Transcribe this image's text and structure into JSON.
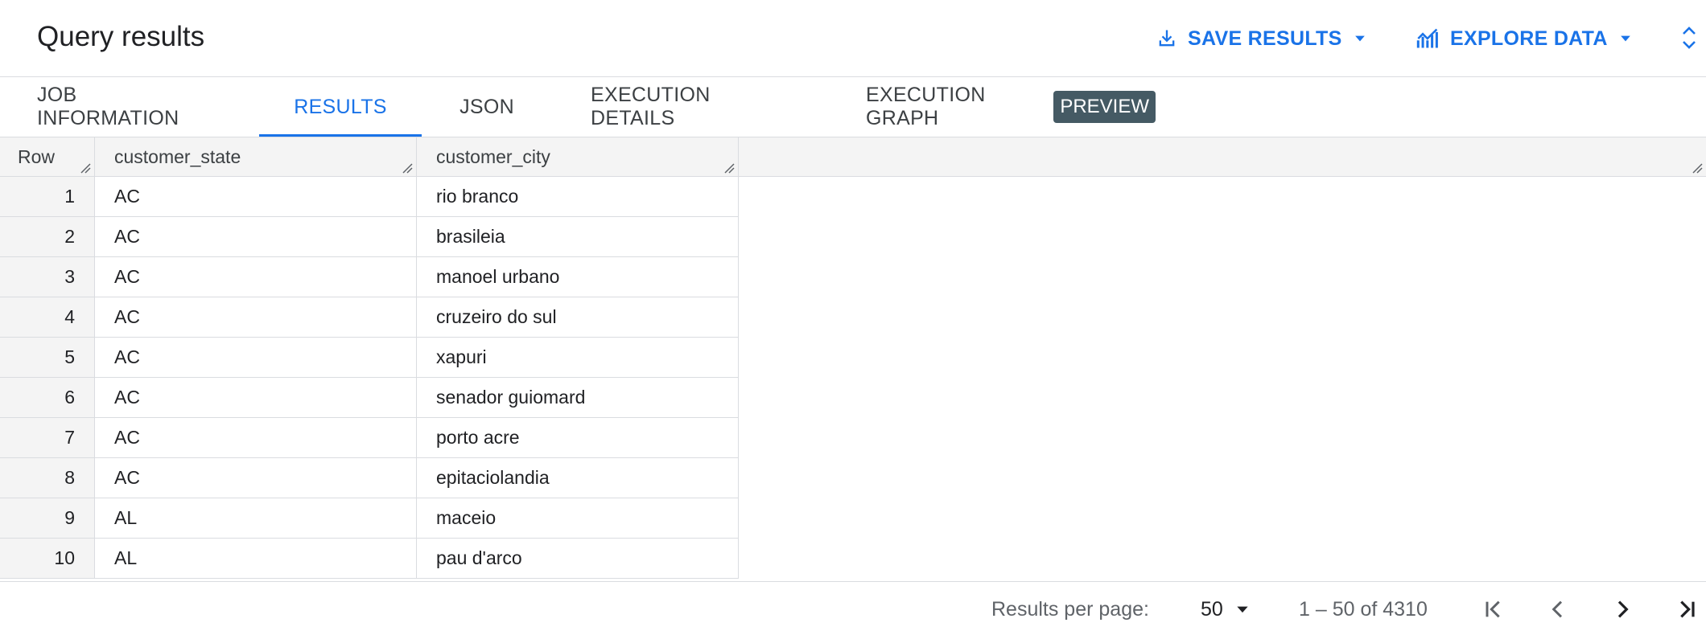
{
  "header": {
    "title": "Query results",
    "save_label": "SAVE RESULTS",
    "explore_label": "EXPLORE DATA"
  },
  "tabs": [
    {
      "label": "JOB INFORMATION"
    },
    {
      "label": "RESULTS",
      "active": true
    },
    {
      "label": "JSON"
    },
    {
      "label": "EXECUTION DETAILS"
    },
    {
      "label": "EXECUTION GRAPH",
      "badge": "PREVIEW"
    }
  ],
  "table": {
    "columns": [
      "Row",
      "customer_state",
      "customer_city"
    ],
    "rows": [
      [
        "1",
        "AC",
        "rio branco"
      ],
      [
        "2",
        "AC",
        "brasileia"
      ],
      [
        "3",
        "AC",
        "manoel urbano"
      ],
      [
        "4",
        "AC",
        "cruzeiro do sul"
      ],
      [
        "5",
        "AC",
        "xapuri"
      ],
      [
        "6",
        "AC",
        "senador guiomard"
      ],
      [
        "7",
        "AC",
        "porto acre"
      ],
      [
        "8",
        "AC",
        "epitaciolandia"
      ],
      [
        "9",
        "AL",
        "maceio"
      ],
      [
        "10",
        "AL",
        "pau d'arco"
      ]
    ]
  },
  "footer": {
    "per_page_label": "Results per page:",
    "per_page_value": "50",
    "range_text": "1 – 50 of 4310"
  },
  "colors": {
    "accent": "#1a73e8",
    "badge_bg": "#455a64",
    "border": "#dadce0",
    "header_bg": "#f4f4f4"
  }
}
